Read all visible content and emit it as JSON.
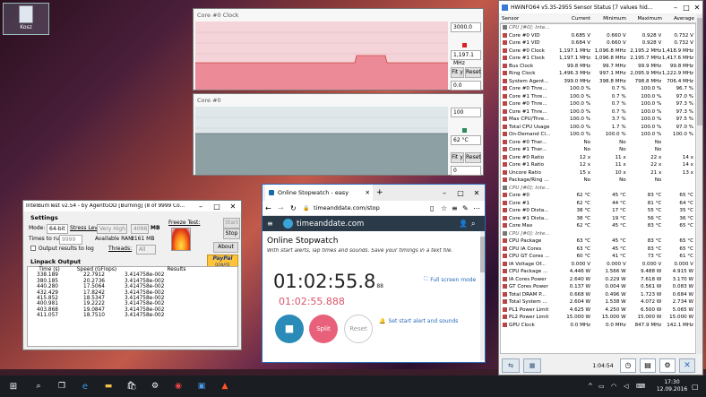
{
  "desktop": {
    "recycle_label": "Kosz"
  },
  "graph1": {
    "title": "Core #0 Clock",
    "max": "3000.0",
    "current": "1,197.1 MHz",
    "min": "0.0",
    "fit": "Fit y",
    "reset": "Reset"
  },
  "graph2": {
    "title": "Core #0",
    "max": "100",
    "current": "62 °C",
    "min": "0",
    "fit": "Fit y",
    "reset": "Reset"
  },
  "intelburn": {
    "title": "IntelBurnTest v2.54 - by AgentGOD [Burning] (8 of 9999 Co...",
    "settings": "Settings",
    "mode_label": "Mode:",
    "mode_value": "64-bit",
    "stress_label": "Stress Level:",
    "stress_value": "Very High",
    "mem_value": "4096",
    "mem_unit": "MB",
    "times_label": "Times to run:",
    "times_value": "9999",
    "ram_label": "Available RAM:",
    "ram_value": "2161 MB",
    "threads_label": "Threads:",
    "threads_value": "All",
    "log_label": "Output results to log",
    "freeze_label": "Freeze Test:",
    "start": "Start",
    "stop": "Stop",
    "about": "About",
    "paypal": "PayPal",
    "donate": "DONATE",
    "linpack": "Linpack Output",
    "col_time": "Time (s)",
    "col_speed": "Speed (GFlops)",
    "col_results": "Results",
    "rows": [
      [
        "338.189",
        "22.7912",
        "3.414758e-002"
      ],
      [
        "380.185",
        "20.2736",
        "3.414758e-002"
      ],
      [
        "440.280",
        "17.5064",
        "3.414758e-002"
      ],
      [
        "432.429",
        "17.8242",
        "3.414758e-002"
      ],
      [
        "415.852",
        "18.5347",
        "3.414758e-002"
      ],
      [
        "400.981",
        "19.2222",
        "3.414758e-002"
      ],
      [
        "403.868",
        "19.0847",
        "3.414758e-002"
      ],
      [
        "411.057",
        "18.7510",
        "3.414758e-002"
      ]
    ]
  },
  "browser": {
    "tab_title": "Online Stopwatch - easy",
    "address": "timeanddate.com/stop",
    "site": "timeanddate.com",
    "heading": "Online Stopwatch",
    "sub": "With start alerts, lap times and sounds. Save your timings in a text file.",
    "fullscreen": "Full screen mode",
    "time_main": "01:02:55.8",
    "time_small": "88",
    "lap_time": "01:02:55.888",
    "stop_btn": "■",
    "split": "Split",
    "reset": "Reset",
    "alert": "Set start alert and sounds"
  },
  "hwinfo": {
    "title": "HWiNFO64 v5.35-2955 Sensor Status [7 values hid...",
    "headers": [
      "Sensor",
      "Current",
      "Minimum",
      "Maximum",
      "Average"
    ],
    "rows": [
      {
        "g": true,
        "c": [
          "CPU [#0]: Inte..."
        ]
      },
      {
        "c": [
          "Core #0 VID",
          "0.685 V",
          "0.660 V",
          "0.928 V",
          "0.732 V"
        ]
      },
      {
        "c": [
          "Core #1 VID",
          "0.684 V",
          "0.660 V",
          "0.928 V",
          "0.732 V"
        ]
      },
      {
        "c": [
          "Core #0 Clock",
          "1,197.1 MHz",
          "1,096.8 MHz",
          "2,195.2 MHz",
          "1,418.9 MHz"
        ]
      },
      {
        "c": [
          "Core #1 Clock",
          "1,197.1 MHz",
          "1,096.8 MHz",
          "2,195.7 MHz",
          "1,417.6 MHz"
        ]
      },
      {
        "c": [
          "Bus Clock",
          "99.8 MHz",
          "99.7 MHz",
          "99.9 MHz",
          "99.8 MHz"
        ]
      },
      {
        "c": [
          "Ring Clock",
          "1,496.3 MHz",
          "997.1 MHz",
          "2,095.9 MHz",
          "1,222.9 MHz"
        ]
      },
      {
        "c": [
          "System Agent...",
          "399.0 MHz",
          "398.8 MHz",
          "798.8 MHz",
          "706.4 MHz"
        ]
      },
      {
        "c": [
          "Core #0 Thre...",
          "100.0 %",
          "0.7 %",
          "100.0 %",
          "96.7 %"
        ]
      },
      {
        "c": [
          "Core #1 Thre...",
          "100.0 %",
          "0.7 %",
          "100.0 %",
          "97.0 %"
        ]
      },
      {
        "c": [
          "Core #0 Thre...",
          "100.0 %",
          "0.7 %",
          "100.0 %",
          "97.3 %"
        ]
      },
      {
        "c": [
          "Core #1 Thre...",
          "100.0 %",
          "0.7 %",
          "100.0 %",
          "97.3 %"
        ]
      },
      {
        "c": [
          "Max CPU/Thre...",
          "100.0 %",
          "3.7 %",
          "100.0 %",
          "97.5 %"
        ]
      },
      {
        "c": [
          "Total CPU Usage",
          "100.0 %",
          "1.7 %",
          "100.0 %",
          "97.0 %"
        ]
      },
      {
        "c": [
          "On-Demand Cl...",
          "100.0 %",
          "100.0 %",
          "100.0 %",
          "100.0 %"
        ]
      },
      {
        "c": [
          "Core #0 Ther...",
          "No",
          "No",
          "No",
          ""
        ]
      },
      {
        "c": [
          "Core #1 Ther...",
          "No",
          "No",
          "No",
          ""
        ]
      },
      {
        "c": [
          "Core #0 Ratio",
          "12 x",
          "11 x",
          "22 x",
          "14 x"
        ]
      },
      {
        "c": [
          "Core #1 Ratio",
          "12 x",
          "11 x",
          "22 x",
          "14 x"
        ]
      },
      {
        "c": [
          "Uncore Ratio",
          "15 x",
          "10 x",
          "21 x",
          "13 x"
        ]
      },
      {
        "c": [
          "Package/Ring ...",
          "No",
          "No",
          "No",
          ""
        ]
      },
      {
        "g": true,
        "c": [
          "CPU [#0]: Inte..."
        ]
      },
      {
        "c": [
          "Core #0",
          "62 °C",
          "45 °C",
          "83 °C",
          "65 °C"
        ]
      },
      {
        "c": [
          "Core #1",
          "62 °C",
          "44 °C",
          "81 °C",
          "64 °C"
        ]
      },
      {
        "c": [
          "Core #0 Dista...",
          "38 °C",
          "17 °C",
          "55 °C",
          "35 °C"
        ]
      },
      {
        "c": [
          "Core #1 Dista...",
          "38 °C",
          "19 °C",
          "56 °C",
          "36 °C"
        ]
      },
      {
        "c": [
          "Core Max",
          "62 °C",
          "45 °C",
          "83 °C",
          "65 °C"
        ]
      },
      {
        "g": true,
        "c": [
          "CPU [#0]: Inte..."
        ]
      },
      {
        "c": [
          "CPU Package",
          "63 °C",
          "45 °C",
          "83 °C",
          "65 °C"
        ]
      },
      {
        "c": [
          "CPU IA Cores",
          "63 °C",
          "45 °C",
          "83 °C",
          "65 °C"
        ]
      },
      {
        "c": [
          "CPU GT Cores ...",
          "60 °C",
          "41 °C",
          "73 °C",
          "61 °C"
        ]
      },
      {
        "c": [
          "IA Voltage Of...",
          "0.000 V",
          "0.000 V",
          "0.000 V",
          "0.000 V"
        ]
      },
      {
        "c": [
          "CPU Package ...",
          "4.446 W",
          "1.566 W",
          "9.488 W",
          "4.915 W"
        ]
      },
      {
        "c": [
          "IA Cores Power",
          "2.640 W",
          "0.229 W",
          "7.618 W",
          "3.170 W"
        ]
      },
      {
        "c": [
          "GT Cores Power",
          "0.137 W",
          "0.004 W",
          "0.561 W",
          "0.083 W"
        ]
      },
      {
        "c": [
          "Total DRAM P...",
          "0.668 W",
          "0.496 W",
          "1.723 W",
          "0.684 W"
        ]
      },
      {
        "c": [
          "Total System ...",
          "2.604 W",
          "1.538 W",
          "4.072 W",
          "2.734 W"
        ]
      },
      {
        "c": [
          "PL1 Power Limit",
          "4.625 W",
          "4.250 W",
          "6.500 W",
          "5.065 W"
        ]
      },
      {
        "c": [
          "PL2 Power Limit",
          "15.000 W",
          "15.000 W",
          "15.000 W",
          "15.000 W"
        ]
      },
      {
        "c": [
          "GPU Clock",
          "0.0 MHz",
          "0.0 MHz",
          "847.9 MHz",
          "142.1 MHz"
        ]
      }
    ],
    "timer": "1:04:54"
  },
  "taskbar": {
    "time": "17:30",
    "date": "12.09.2016"
  }
}
